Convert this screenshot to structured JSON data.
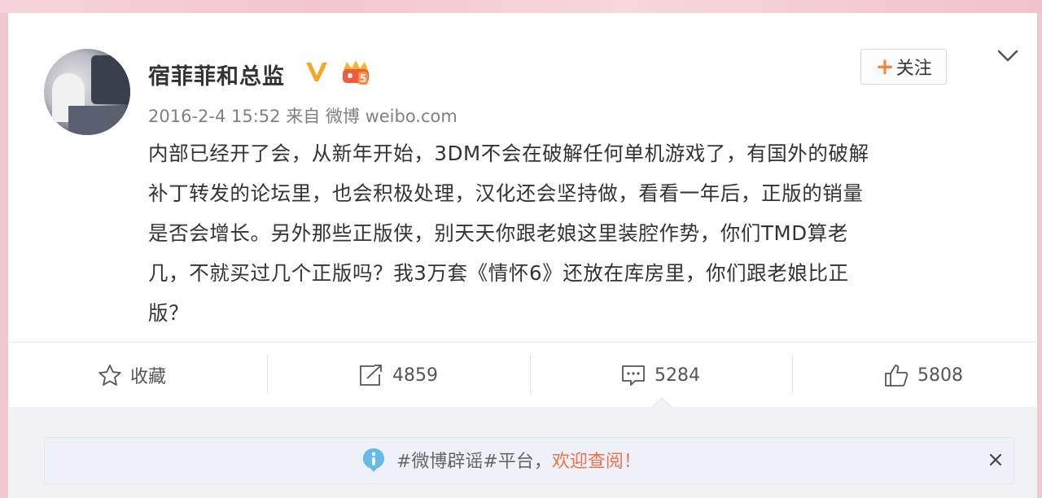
{
  "post": {
    "username": "宿菲菲和总监",
    "timestamp": "2016-2-4 15:52",
    "source_prefix": "来自",
    "source": "微博 weibo.com",
    "follow_label": "关注",
    "vip_level": "5",
    "body_lines": [
      "内部已经开了会，从新年开始，3DM不会在破解任何单机游戏了，有国外的破解",
      "补丁转发的论坛里，也会积极处理，汉化还会坚持做，看看一年后，正版的销量",
      "是否会增长。另外那些正版侠，别天天你跟老娘这里装腔作势，你们TMD算老",
      "几，不就买过几个正版吗？我3万套《情怀6》还放在库房里，你们跟老娘比正",
      "版？"
    ]
  },
  "actions": {
    "favorite_label": "收藏",
    "repost_count": "4859",
    "comment_count": "5284",
    "like_count": "5808"
  },
  "notice": {
    "text_prefix": "#微博辟谣#平台，",
    "text_highlight": "欢迎查阅！"
  },
  "colors": {
    "accent_orange": "#ff8140",
    "verified_gold": "#f5a623",
    "highlight": "#eb7350",
    "info_blue": "#69b9e8"
  }
}
